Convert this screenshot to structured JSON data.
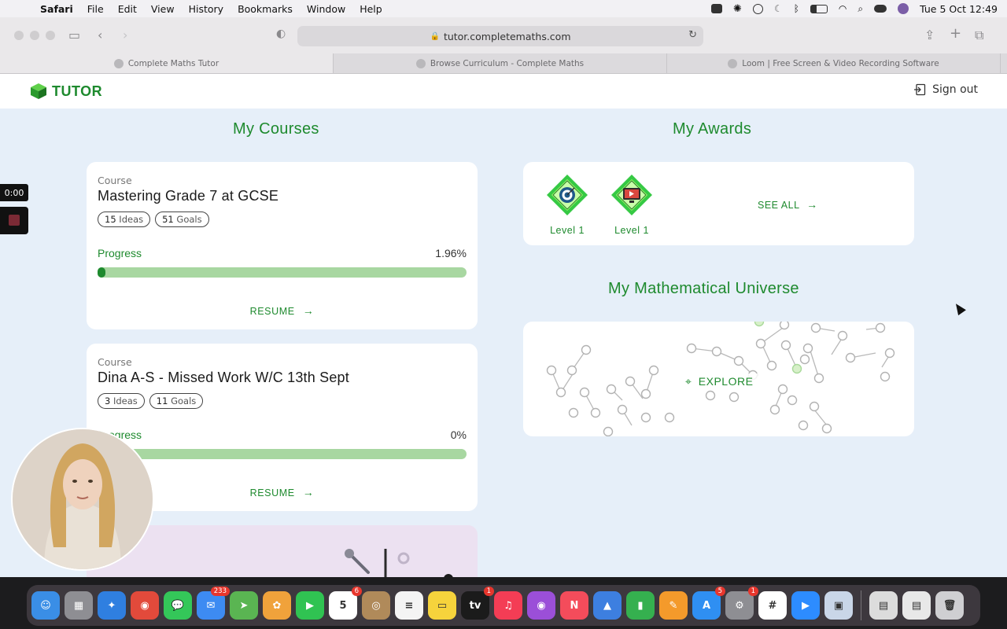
{
  "menubar": {
    "app": "Safari",
    "items": [
      "File",
      "Edit",
      "View",
      "History",
      "Bookmarks",
      "Window",
      "Help"
    ],
    "datetime": "Tue 5 Oct  12:49"
  },
  "browser": {
    "url": "tutor.completemaths.com",
    "tabs": [
      {
        "title": "Complete Maths Tutor",
        "active": true
      },
      {
        "title": "Browse Curriculum - Complete Maths",
        "active": false
      },
      {
        "title": "Loom | Free Screen & Video Recording Software",
        "active": false
      }
    ]
  },
  "header": {
    "logo_text": "TUTOR",
    "signout_label": "Sign out"
  },
  "courses_section": {
    "title": "My Courses",
    "courses": [
      {
        "label": "Course",
        "title": "Mastering Grade 7 at GCSE",
        "ideas_count": "15",
        "ideas_label": "Ideas",
        "goals_count": "51",
        "goals_label": "Goals",
        "progress_label": "Progress",
        "progress_value": "1.96%",
        "progress_fraction": 0.0196,
        "resume_label": "RESUME"
      },
      {
        "label": "Course",
        "title": "Dina A-S - Missed Work W/C 13th Sept",
        "ideas_count": "3",
        "ideas_label": "Ideas",
        "goals_count": "11",
        "goals_label": "Goals",
        "progress_label": "Progress",
        "progress_value": "0%",
        "progress_fraction": 0,
        "resume_label": "RESUME"
      }
    ]
  },
  "awards_section": {
    "title": "My Awards",
    "awards": [
      {
        "level": "Level 1",
        "icon": "target-icon"
      },
      {
        "level": "Level 1",
        "icon": "video-screen-icon"
      }
    ],
    "see_all_label": "SEE ALL"
  },
  "universe_section": {
    "title": "My Mathematical Universe",
    "explore_label": "EXPLORE"
  },
  "loom": {
    "timer": "0:00"
  },
  "dock": {
    "apps": [
      {
        "name": "finder",
        "color": "#3a8ee6",
        "glyph": "☺"
      },
      {
        "name": "launchpad",
        "color": "#8e8e93",
        "glyph": "▦"
      },
      {
        "name": "safari",
        "color": "#2f7fe0",
        "glyph": "✦"
      },
      {
        "name": "chrome",
        "color": "#e24a3b",
        "glyph": "◉"
      },
      {
        "name": "messages",
        "color": "#34c759",
        "glyph": "💬"
      },
      {
        "name": "mail",
        "color": "#3d8bf2",
        "glyph": "✉",
        "badge": "233"
      },
      {
        "name": "maps",
        "color": "#5ab552",
        "glyph": "➤"
      },
      {
        "name": "photos",
        "color": "#f0a23b",
        "glyph": "✿"
      },
      {
        "name": "facetime",
        "color": "#30c352",
        "glyph": "▶"
      },
      {
        "name": "calendar",
        "color": "#ffffff",
        "glyph": "5",
        "badge": "6"
      },
      {
        "name": "contacts",
        "color": "#b08a5a",
        "glyph": "◎"
      },
      {
        "name": "reminders",
        "color": "#f4f4f4",
        "glyph": "≡"
      },
      {
        "name": "notes",
        "color": "#f6d33c",
        "glyph": "▭"
      },
      {
        "name": "tv",
        "color": "#1b1b1b",
        "glyph": "tv",
        "badge": "1"
      },
      {
        "name": "music",
        "color": "#f43d55",
        "glyph": "♫"
      },
      {
        "name": "podcasts",
        "color": "#9b4fd8",
        "glyph": "◉"
      },
      {
        "name": "news",
        "color": "#f44c5b",
        "glyph": "N"
      },
      {
        "name": "keynote",
        "color": "#3d7fe0",
        "glyph": "▲"
      },
      {
        "name": "numbers",
        "color": "#35b04f",
        "glyph": "▮"
      },
      {
        "name": "pages",
        "color": "#f49a2b",
        "glyph": "✎"
      },
      {
        "name": "app-store",
        "color": "#2f8ff2",
        "glyph": "A",
        "badge": "5"
      },
      {
        "name": "system-preferences",
        "color": "#8e8e93",
        "glyph": "⚙",
        "badge": "1"
      },
      {
        "name": "slack",
        "color": "#ffffff",
        "glyph": "#"
      },
      {
        "name": "zoom",
        "color": "#2d8cff",
        "glyph": "▶"
      },
      {
        "name": "preview",
        "color": "#c9d6e8",
        "glyph": "▣"
      }
    ],
    "trailing": [
      {
        "name": "downloads-stack",
        "color": "#dcdcdc",
        "glyph": "▤"
      },
      {
        "name": "documents-stack",
        "color": "#e8e8e8",
        "glyph": "▤"
      },
      {
        "name": "trash",
        "color": "#cfcfd2",
        "glyph": "🗑"
      }
    ]
  }
}
